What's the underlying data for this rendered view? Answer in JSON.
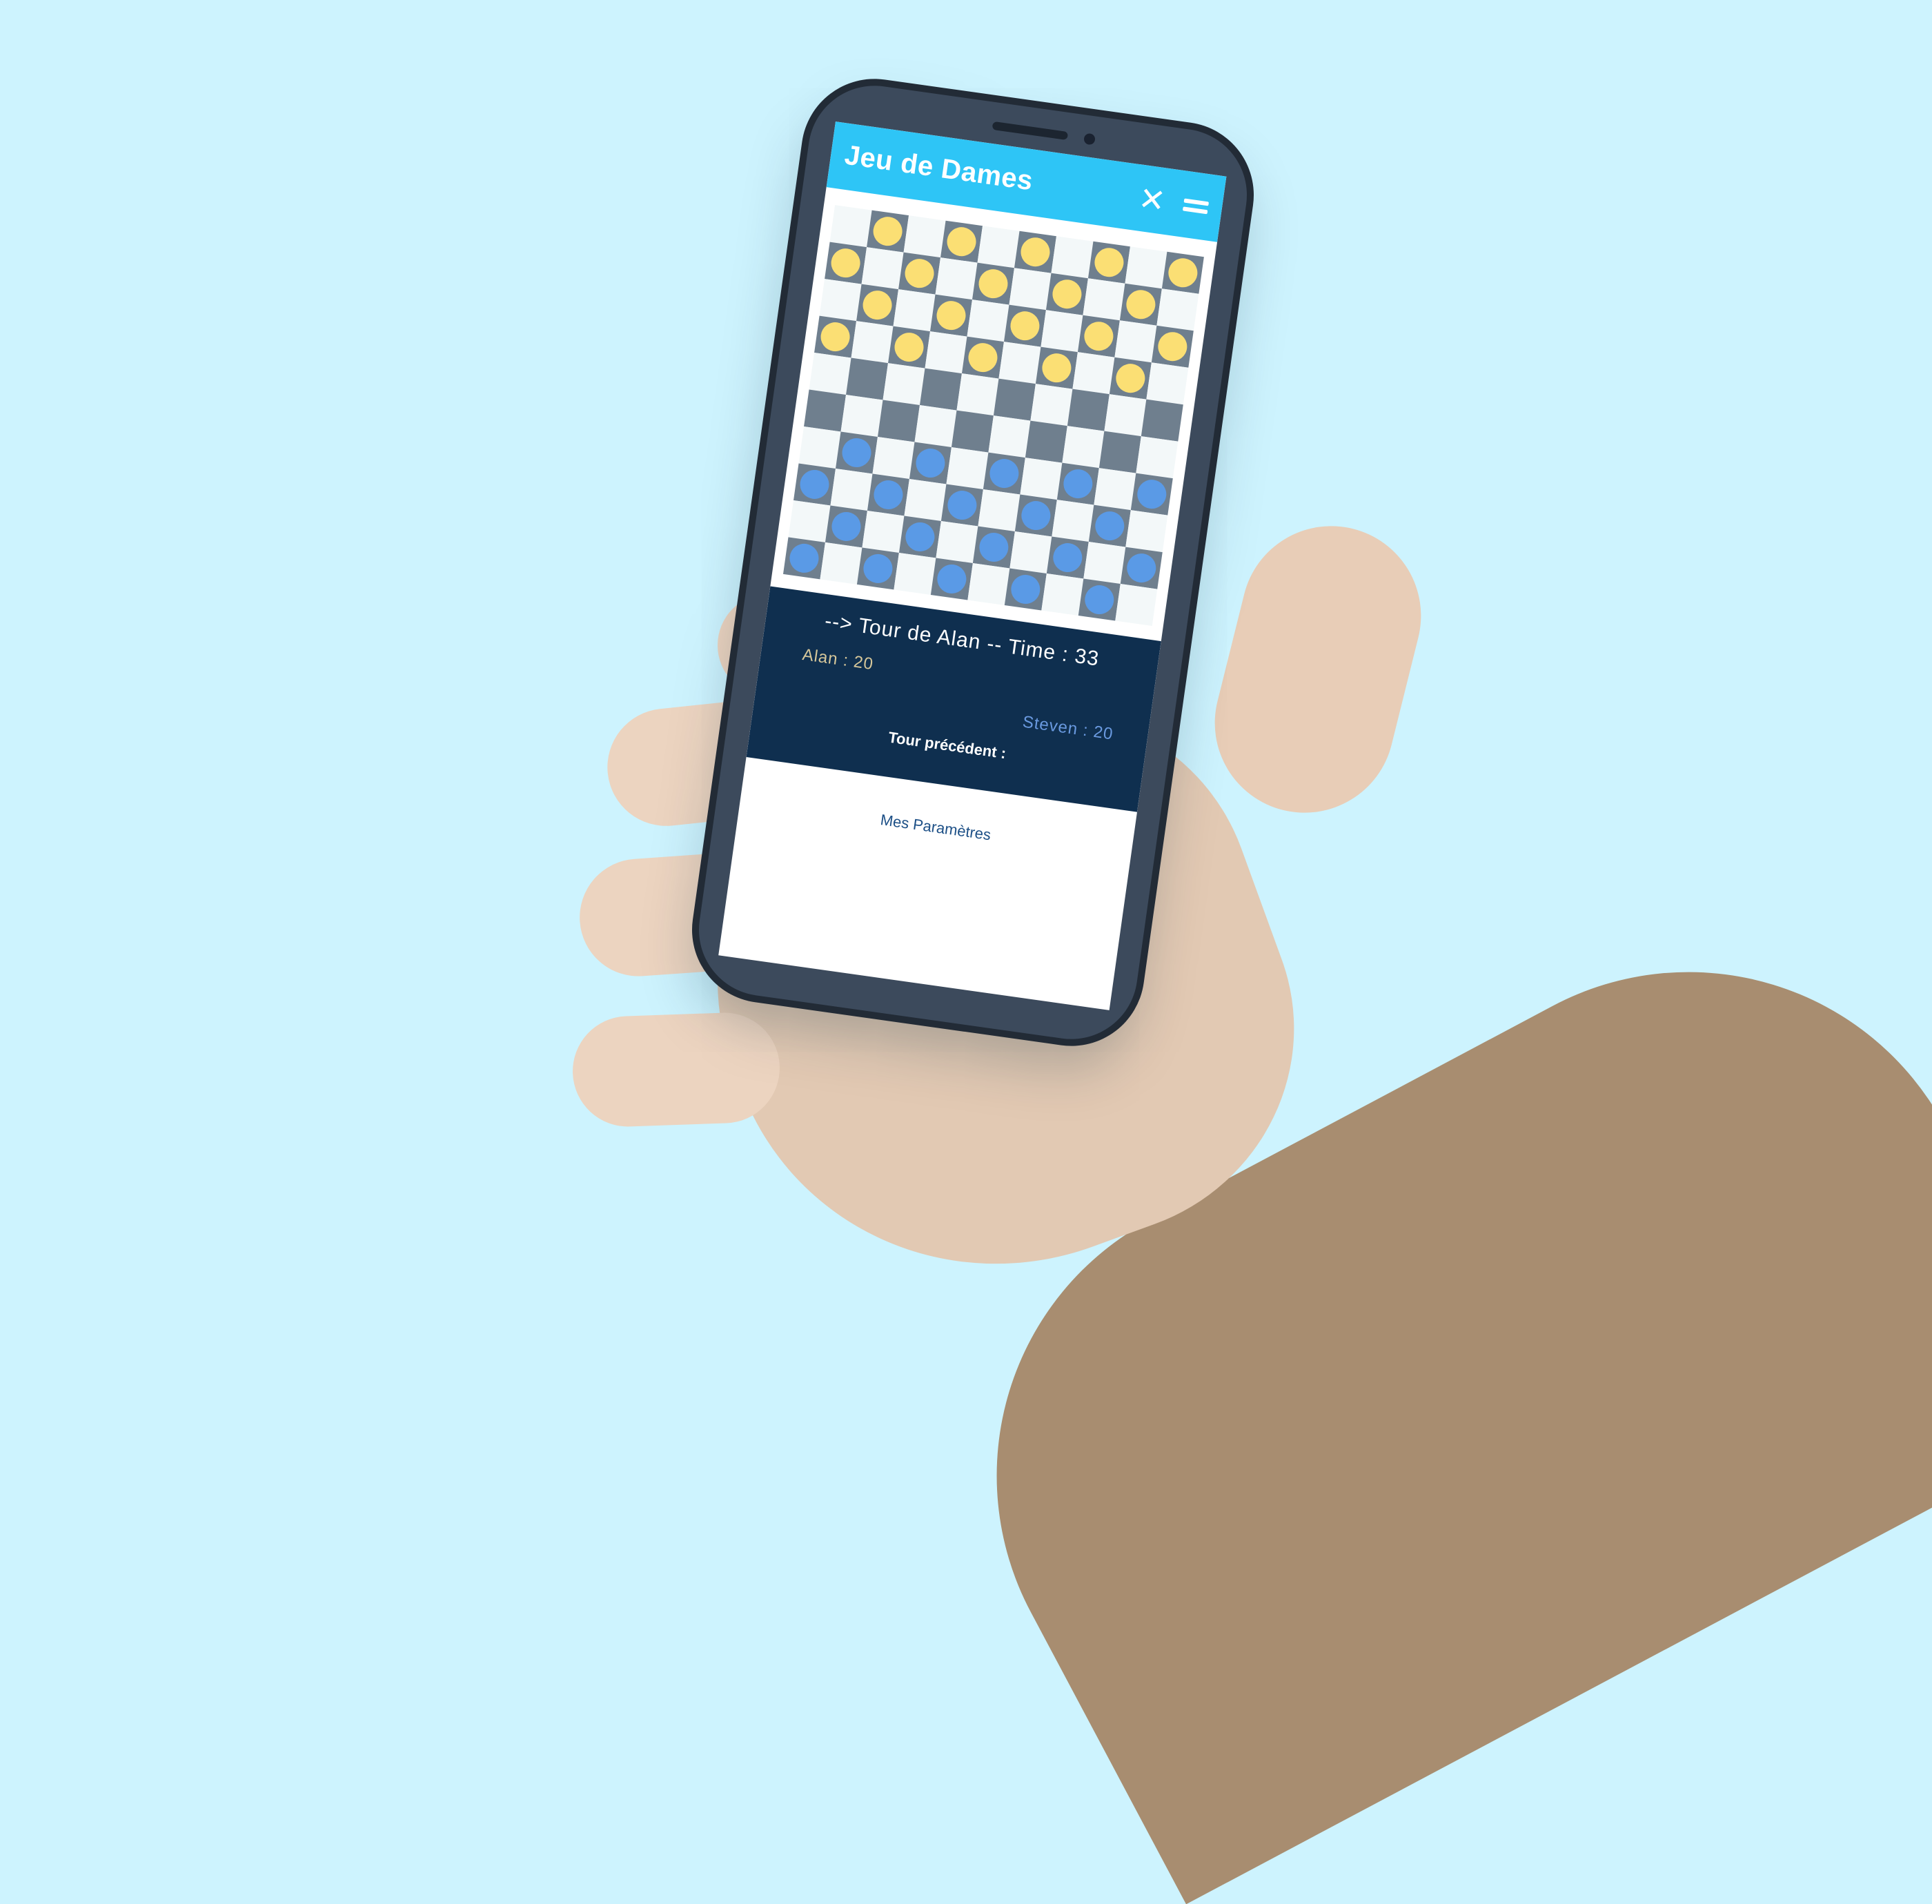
{
  "app": {
    "title": "Jeu de Dames",
    "close_icon": "close-icon",
    "menu_icon": "menu-icon"
  },
  "board": {
    "size": 10,
    "colors": {
      "light": "#f3f8f9",
      "dark": "#6f7f8e",
      "player1": "#fbdf74",
      "player2": "#5a9ae6"
    },
    "rows": [
      "_y_y_y_y_y",
      "y_y_y_y_y_",
      "_y_y_y_y_y",
      "y_y_y_y_y_",
      "__________",
      "__________",
      "_b_b_b_b_b",
      "b_b_b_b_b_",
      "_b_b_b_b_b",
      "b_b_b_b_b_"
    ]
  },
  "status": {
    "turn": "--> Tour de Alan -- Time : 33",
    "player1_score": "Alan : 20",
    "player2_score": "Steven : 20",
    "previous_turn": "Tour précédent :"
  },
  "footer": {
    "settings_link": "Mes Paramètres"
  }
}
